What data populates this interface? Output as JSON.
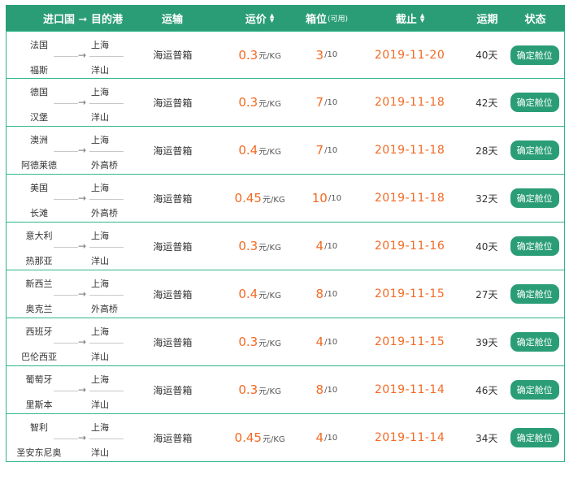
{
  "header": {
    "route": "进口国 ➞ 目的港",
    "transport": "运输",
    "price": "运价",
    "box": "箱位",
    "box_small": "(可用)",
    "cutoff": "截止",
    "days": "运期",
    "status": "状态"
  },
  "rows": [
    {
      "origin_country": "法国",
      "origin_port": "福斯",
      "dest_city": "上海",
      "dest_port": "洋山",
      "transport": "海运普箱",
      "price": "0.3",
      "price_unit": "元/KG",
      "box_avail": "3",
      "box_total": "/10",
      "cutoff": "2019-11-20",
      "days": "40天",
      "action": "确定舱位"
    },
    {
      "origin_country": "德国",
      "origin_port": "汉堡",
      "dest_city": "上海",
      "dest_port": "洋山",
      "transport": "海运普箱",
      "price": "0.3",
      "price_unit": "元/KG",
      "box_avail": "7",
      "box_total": "/10",
      "cutoff": "2019-11-18",
      "days": "42天",
      "action": "确定舱位"
    },
    {
      "origin_country": "澳洲",
      "origin_port": "阿德莱德",
      "dest_city": "上海",
      "dest_port": "外高桥",
      "transport": "海运普箱",
      "price": "0.4",
      "price_unit": "元/KG",
      "box_avail": "7",
      "box_total": "/10",
      "cutoff": "2019-11-18",
      "days": "28天",
      "action": "确定舱位"
    },
    {
      "origin_country": "美国",
      "origin_port": "长滩",
      "dest_city": "上海",
      "dest_port": "外高桥",
      "transport": "海运普箱",
      "price": "0.45",
      "price_unit": "元/KG",
      "box_avail": "10",
      "box_total": "/10",
      "cutoff": "2019-11-18",
      "days": "32天",
      "action": "确定舱位"
    },
    {
      "origin_country": "意大利",
      "origin_port": "热那亚",
      "dest_city": "上海",
      "dest_port": "洋山",
      "transport": "海运普箱",
      "price": "0.3",
      "price_unit": "元/KG",
      "box_avail": "4",
      "box_total": "/10",
      "cutoff": "2019-11-16",
      "days": "40天",
      "action": "确定舱位"
    },
    {
      "origin_country": "新西兰",
      "origin_port": "奥克兰",
      "dest_city": "上海",
      "dest_port": "外高桥",
      "transport": "海运普箱",
      "price": "0.4",
      "price_unit": "元/KG",
      "box_avail": "8",
      "box_total": "/10",
      "cutoff": "2019-11-15",
      "days": "27天",
      "action": "确定舱位"
    },
    {
      "origin_country": "西班牙",
      "origin_port": "巴伦西亚",
      "dest_city": "上海",
      "dest_port": "洋山",
      "transport": "海运普箱",
      "price": "0.3",
      "price_unit": "元/KG",
      "box_avail": "4",
      "box_total": "/10",
      "cutoff": "2019-11-15",
      "days": "39天",
      "action": "确定舱位"
    },
    {
      "origin_country": "葡萄牙",
      "origin_port": "里斯本",
      "dest_city": "上海",
      "dest_port": "洋山",
      "transport": "海运普箱",
      "price": "0.3",
      "price_unit": "元/KG",
      "box_avail": "8",
      "box_total": "/10",
      "cutoff": "2019-11-14",
      "days": "46天",
      "action": "确定舱位"
    },
    {
      "origin_country": "智利",
      "origin_port": "圣安东尼奥",
      "dest_city": "上海",
      "dest_port": "洋山",
      "transport": "海运普箱",
      "price": "0.45",
      "price_unit": "元/KG",
      "box_avail": "4",
      "box_total": "/10",
      "cutoff": "2019-11-14",
      "days": "34天",
      "action": "确定舱位"
    }
  ],
  "colors": {
    "accent": "#2a9d77",
    "highlight": "#f36a24",
    "border": "#2fb58a"
  },
  "icons": {
    "sort": "sort-up-down-icon",
    "route_arrow": "right-arrow-icon"
  }
}
